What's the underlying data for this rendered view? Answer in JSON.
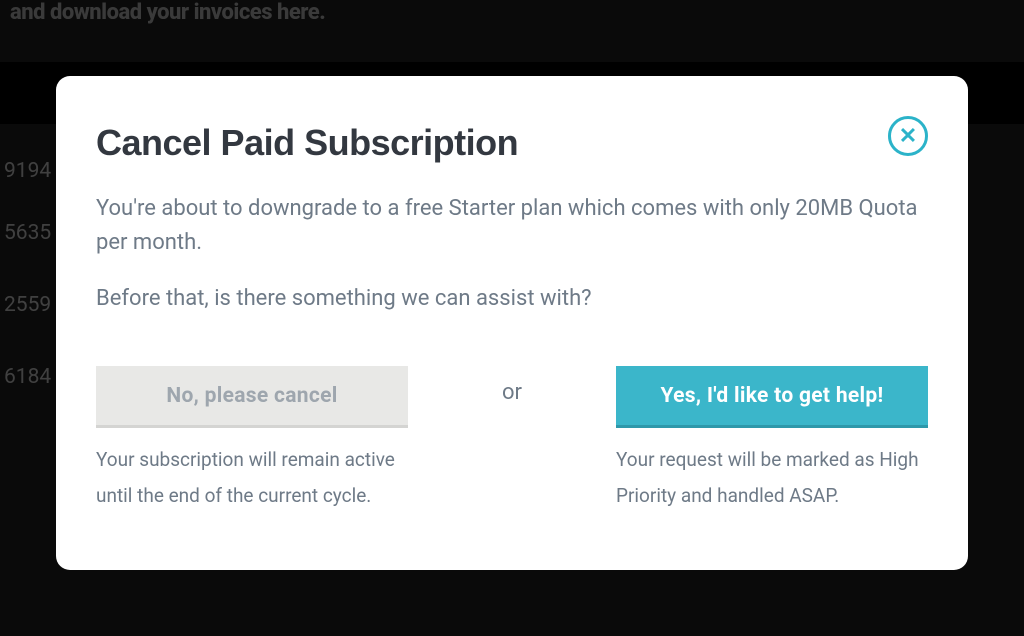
{
  "backdrop": {
    "header_fragment": "and download your invoices here.",
    "rows": [
      "9194",
      "5635",
      "2559",
      "6184"
    ]
  },
  "modal": {
    "title": "Cancel Paid Subscription",
    "close_icon": "✕",
    "body_line1": "You're about to downgrade to a free Starter plan which comes with only 20MB Quota per month.",
    "body_line2": "Before that, is there something we can assist with?",
    "or_label": "or",
    "cancel_button": {
      "label": "No, please cancel",
      "caption": "Your subscription will remain active until the end of the current cycle."
    },
    "help_button": {
      "label": "Yes, I'd like to get help!",
      "caption": "Your request will be marked as High Priority and handled ASAP."
    }
  }
}
